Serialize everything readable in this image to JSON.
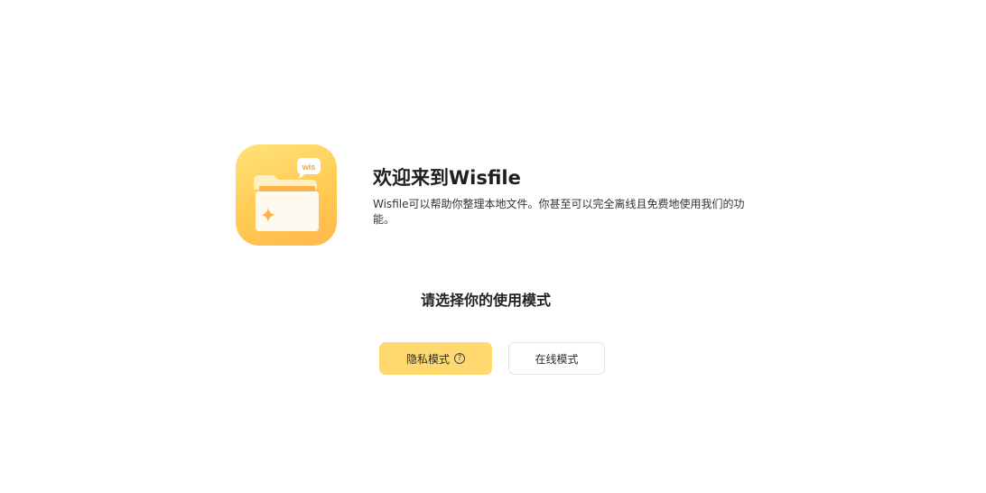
{
  "welcome": {
    "title": "欢迎来到Wisfile",
    "description": "Wisfile可以帮助你整理本地文件。你甚至可以完全离线且免费地使用我们的功能。"
  },
  "app_icon": {
    "icon_name": "wisfile-folder-icon",
    "badge_text": "wis"
  },
  "mode_selection": {
    "prompt": "请选择你的使用模式",
    "private_label": "隐私模式",
    "private_help_icon": "question-circle-icon",
    "online_label": "在线模式"
  },
  "colors": {
    "accent": "#ffd970",
    "icon_gradient_top": "#ffe27a",
    "icon_gradient_bottom": "#ffb84a"
  }
}
